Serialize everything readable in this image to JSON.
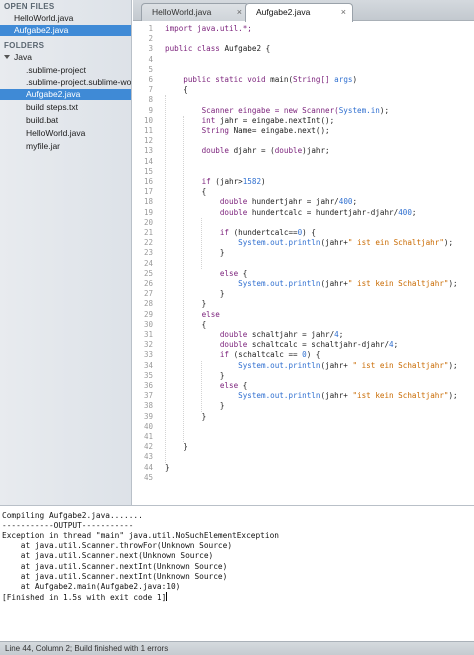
{
  "sidebar": {
    "open_files_header": "OPEN FILES",
    "open_files": [
      "HelloWorld.java",
      "Aufgabe2.java"
    ],
    "folders_header": "FOLDERS",
    "folder_name": "Java",
    "folder_items": [
      ".sublime-project",
      ".sublime-project.sublime-work",
      "Aufgabe2.java",
      "build steps.txt",
      "build.bat",
      "HelloWorld.java",
      "myfile.jar"
    ]
  },
  "tabs": [
    {
      "label": "HelloWorld.java",
      "close": "×"
    },
    {
      "label": "Aufgabe2.java",
      "close": "×"
    }
  ],
  "editor": {
    "line_numbers": [
      "1",
      "2",
      "3",
      "4",
      "5",
      "6",
      "7",
      "8",
      "9",
      "10",
      "11",
      "12",
      "13",
      "14",
      "15",
      "16",
      "17",
      "18",
      "19",
      "20",
      "21",
      "22",
      "23",
      "24",
      "25",
      "26",
      "27",
      "28",
      "29",
      "30",
      "31",
      "32",
      "33",
      "34",
      "35",
      "36",
      "37",
      "38",
      "39",
      "40",
      "41",
      "42",
      "43",
      "44",
      "45"
    ],
    "lines": [
      [
        {
          "t": "import java.util.*;",
          "c": "#7a1f7a"
        }
      ],
      [],
      [
        {
          "t": "public class ",
          "c": "#7a1f7a"
        },
        {
          "t": "Aufgabe2 {",
          "c": "#222222"
        }
      ],
      [],
      [],
      [
        {
          "t": "    public static void ",
          "c": "#7a1f7a"
        },
        {
          "t": "main(",
          "c": "#222222"
        },
        {
          "t": "String[] ",
          "c": "#7a1f7a"
        },
        {
          "t": "args",
          "c": "#2f6fd0"
        },
        {
          "t": ")",
          "c": "#222222"
        }
      ],
      [
        {
          "t": "    {",
          "c": "#222222"
        }
      ],
      [],
      [
        {
          "t": "        Scanner eingabe = new Scanner(",
          "c": "#7a1f7a"
        },
        {
          "t": "System.in",
          "c": "#2f6fd0"
        },
        {
          "t": ");",
          "c": "#222222"
        }
      ],
      [
        {
          "t": "        int ",
          "c": "#7a1f7a"
        },
        {
          "t": "jahr = eingabe.nextInt();",
          "c": "#222222"
        }
      ],
      [
        {
          "t": "        String ",
          "c": "#7a1f7a"
        },
        {
          "t": "Name= eingabe.next();",
          "c": "#222222"
        }
      ],
      [],
      [
        {
          "t": "        double ",
          "c": "#7a1f7a"
        },
        {
          "t": "djahr = (",
          "c": "#222222"
        },
        {
          "t": "double",
          "c": "#7a1f7a"
        },
        {
          "t": ")jahr;",
          "c": "#222222"
        }
      ],
      [],
      [],
      [
        {
          "t": "        if ",
          "c": "#7a1f7a"
        },
        {
          "t": "(jahr>",
          "c": "#222222"
        },
        {
          "t": "1582",
          "c": "#2f6fd0"
        },
        {
          "t": ")",
          "c": "#222222"
        }
      ],
      [
        {
          "t": "        {",
          "c": "#222222"
        }
      ],
      [
        {
          "t": "            double ",
          "c": "#7a1f7a"
        },
        {
          "t": "hundertjahr = jahr/",
          "c": "#222222"
        },
        {
          "t": "400",
          "c": "#2f6fd0"
        },
        {
          "t": ";",
          "c": "#222222"
        }
      ],
      [
        {
          "t": "            double ",
          "c": "#7a1f7a"
        },
        {
          "t": "hundertcalc = hundertjahr-djahr/",
          "c": "#222222"
        },
        {
          "t": "400",
          "c": "#2f6fd0"
        },
        {
          "t": ";",
          "c": "#222222"
        }
      ],
      [],
      [
        {
          "t": "            if ",
          "c": "#7a1f7a"
        },
        {
          "t": "(hundertcalc==",
          "c": "#222222"
        },
        {
          "t": "0",
          "c": "#2f6fd0"
        },
        {
          "t": ") {",
          "c": "#222222"
        }
      ],
      [
        {
          "t": "                System.out.println",
          "c": "#2f6fd0"
        },
        {
          "t": "(jahr+",
          "c": "#222222"
        },
        {
          "t": "\" ist ein Schaltjahr\"",
          "c": "#c96a00"
        },
        {
          "t": ");",
          "c": "#222222"
        }
      ],
      [
        {
          "t": "            }",
          "c": "#222222"
        }
      ],
      [],
      [
        {
          "t": "            else ",
          "c": "#7a1f7a"
        },
        {
          "t": "{",
          "c": "#222222"
        }
      ],
      [
        {
          "t": "                System.out.println",
          "c": "#2f6fd0"
        },
        {
          "t": "(jahr+",
          "c": "#222222"
        },
        {
          "t": "\" ist kein Schaltjahr\"",
          "c": "#c96a00"
        },
        {
          "t": ");",
          "c": "#222222"
        }
      ],
      [
        {
          "t": "            }",
          "c": "#222222"
        }
      ],
      [
        {
          "t": "        }",
          "c": "#222222"
        }
      ],
      [
        {
          "t": "        else",
          "c": "#7a1f7a"
        }
      ],
      [
        {
          "t": "        {",
          "c": "#222222"
        }
      ],
      [
        {
          "t": "            double ",
          "c": "#7a1f7a"
        },
        {
          "t": "schaltjahr = jahr/",
          "c": "#222222"
        },
        {
          "t": "4",
          "c": "#2f6fd0"
        },
        {
          "t": ";",
          "c": "#222222"
        }
      ],
      [
        {
          "t": "            double ",
          "c": "#7a1f7a"
        },
        {
          "t": "schaltcalc = schaltjahr-djahr/",
          "c": "#222222"
        },
        {
          "t": "4",
          "c": "#2f6fd0"
        },
        {
          "t": ";",
          "c": "#222222"
        }
      ],
      [
        {
          "t": "            if ",
          "c": "#7a1f7a"
        },
        {
          "t": "(schaltcalc == ",
          "c": "#222222"
        },
        {
          "t": "0",
          "c": "#2f6fd0"
        },
        {
          "t": ") {",
          "c": "#222222"
        }
      ],
      [
        {
          "t": "                System.out.println",
          "c": "#2f6fd0"
        },
        {
          "t": "(jahr+ ",
          "c": "#222222"
        },
        {
          "t": "\" ist ein Schaltjahr\"",
          "c": "#c96a00"
        },
        {
          "t": ");",
          "c": "#222222"
        }
      ],
      [
        {
          "t": "            }",
          "c": "#222222"
        }
      ],
      [
        {
          "t": "            else ",
          "c": "#7a1f7a"
        },
        {
          "t": "{",
          "c": "#222222"
        }
      ],
      [
        {
          "t": "                System.out.println",
          "c": "#2f6fd0"
        },
        {
          "t": "(jahr+ ",
          "c": "#222222"
        },
        {
          "t": "\"ist kein Schaltjahr\"",
          "c": "#c96a00"
        },
        {
          "t": ");",
          "c": "#222222"
        }
      ],
      [
        {
          "t": "            }",
          "c": "#222222"
        }
      ],
      [
        {
          "t": "        }",
          "c": "#222222"
        }
      ],
      [],
      [],
      [
        {
          "t": "    }",
          "c": "#222222"
        }
      ],
      [],
      [
        {
          "t": "}",
          "c": "#222222"
        }
      ],
      []
    ]
  },
  "output": {
    "lines": [
      "Compiling Aufgabe2.java.......",
      "-----------OUTPUT-----------",
      "Exception in thread \"main\" java.util.NoSuchElementException",
      "    at java.util.Scanner.throwFor(Unknown Source)",
      "    at java.util.Scanner.next(Unknown Source)",
      "    at java.util.Scanner.nextInt(Unknown Source)",
      "    at java.util.Scanner.nextInt(Unknown Source)",
      "    at Aufgabe2.main(Aufgabe2.java:10)",
      "[Finished in 1.5s with exit code 1]"
    ]
  },
  "status_bar": {
    "text": "Line 44, Column 2; Build finished with 1 errors"
  },
  "colors": {
    "keyword": "#7a1f7a",
    "builtin": "#2f6fd0",
    "string": "#c96a00",
    "plain": "#222222",
    "selection": "#3f8ad6"
  }
}
